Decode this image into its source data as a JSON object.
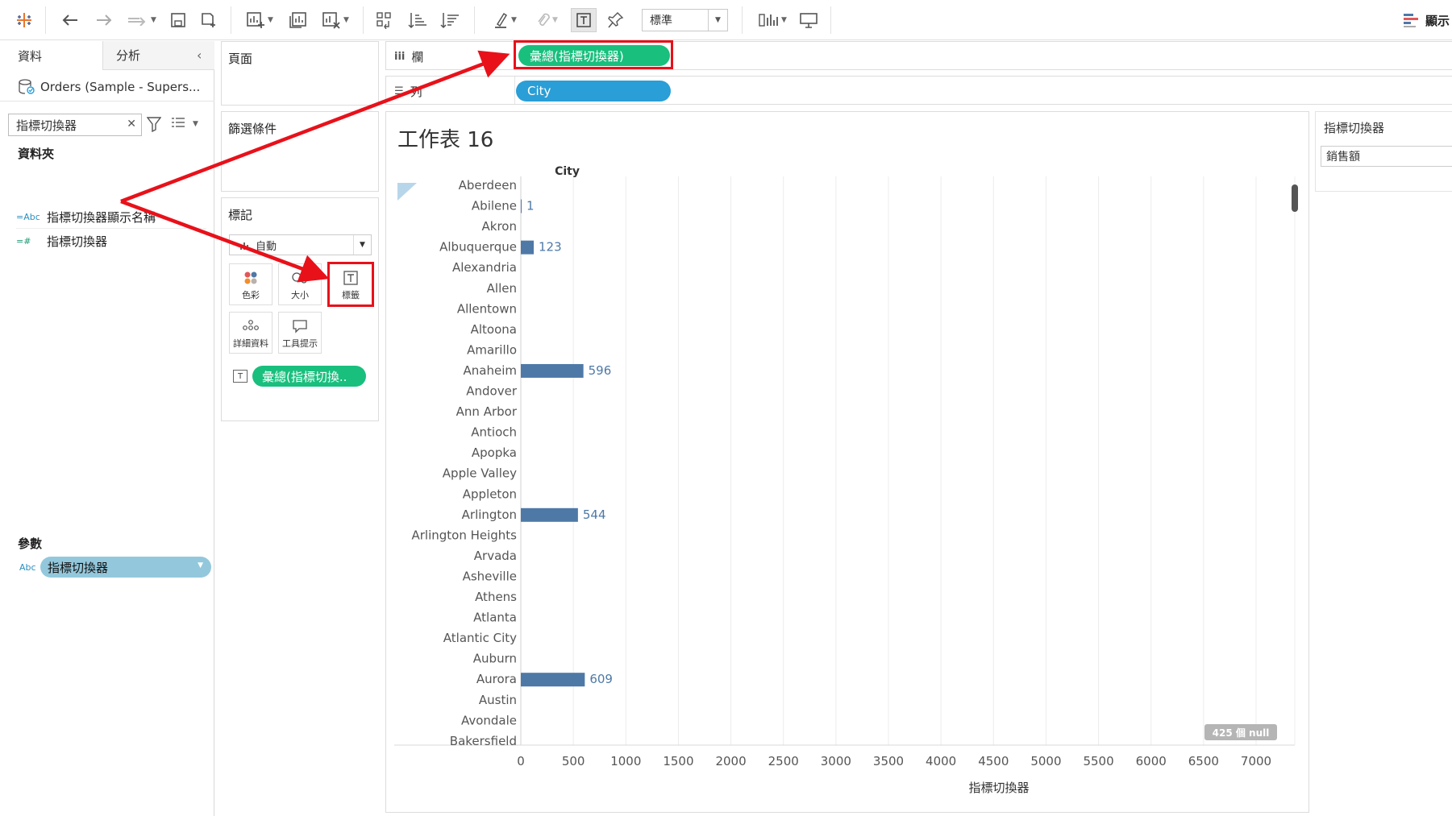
{
  "toolbar": {
    "mark_size": "標準",
    "show_label": "顯示"
  },
  "data_pane": {
    "tab_data": "資料",
    "tab_analysis": "分析",
    "datasource": "Orders (Sample - Supers...",
    "search_value": "指標切換器",
    "folder_heading": "資料夾",
    "fields": [
      {
        "type": "=Abc",
        "name": "指標切換器顯示名稱"
      },
      {
        "type": "=#",
        "name": "指標切換器"
      }
    ],
    "params_heading": "參數",
    "param": {
      "type": "Abc",
      "name": "指標切換器"
    }
  },
  "shelves": {
    "pages": "頁面",
    "filters": "篩選條件",
    "marks": "標記",
    "mark_type": "自動",
    "mark_buttons": {
      "color": "色彩",
      "size": "大小",
      "label": "標籤",
      "detail": "詳細資料",
      "tooltip": "工具提示"
    },
    "marks_pill": "彙總(指標切換..",
    "columns": "欄",
    "rows": "列",
    "columns_pill": "彙總(指標切換器)",
    "rows_pill": "City"
  },
  "view": {
    "sheet_title": "工作表 16",
    "null_badge": "425 個 null",
    "xaxis_title": "指標切換器"
  },
  "param_control": {
    "title": "指標切換器",
    "value": "銷售額"
  },
  "colors": {
    "bar": "#4e79a7",
    "label_text": "#4e79a7",
    "green_pill": "#19bf7d",
    "blue_pill": "#2a9ed6",
    "annotation": "#e8111a"
  },
  "chart_data": {
    "type": "bar",
    "orientation": "horizontal",
    "row_header": "City",
    "xlabel": "指標切換器",
    "xlim": [
      0,
      7000
    ],
    "xticks": [
      0,
      500,
      1000,
      1500,
      2000,
      2500,
      3000,
      3500,
      4000,
      4500,
      5000,
      5500,
      6000,
      6500,
      7000
    ],
    "categories": [
      "Aberdeen",
      "Abilene",
      "Akron",
      "Albuquerque",
      "Alexandria",
      "Allen",
      "Allentown",
      "Altoona",
      "Amarillo",
      "Anaheim",
      "Andover",
      "Ann Arbor",
      "Antioch",
      "Apopka",
      "Apple Valley",
      "Appleton",
      "Arlington",
      "Arlington Heights",
      "Arvada",
      "Asheville",
      "Athens",
      "Atlanta",
      "Atlantic City",
      "Auburn",
      "Aurora",
      "Austin",
      "Avondale",
      "Bakersfield"
    ],
    "values": [
      null,
      1,
      null,
      123,
      null,
      null,
      null,
      null,
      null,
      596,
      null,
      null,
      null,
      null,
      null,
      null,
      544,
      null,
      null,
      null,
      null,
      null,
      null,
      null,
      609,
      null,
      null,
      null
    ],
    "data_labels": [
      "",
      "1",
      "",
      "123",
      "",
      "",
      "",
      "",
      "",
      "596",
      "",
      "",
      "",
      "",
      "",
      "",
      "544",
      "",
      "",
      "",
      "",
      "",
      "",
      "",
      "609",
      "",
      "",
      ""
    ]
  }
}
